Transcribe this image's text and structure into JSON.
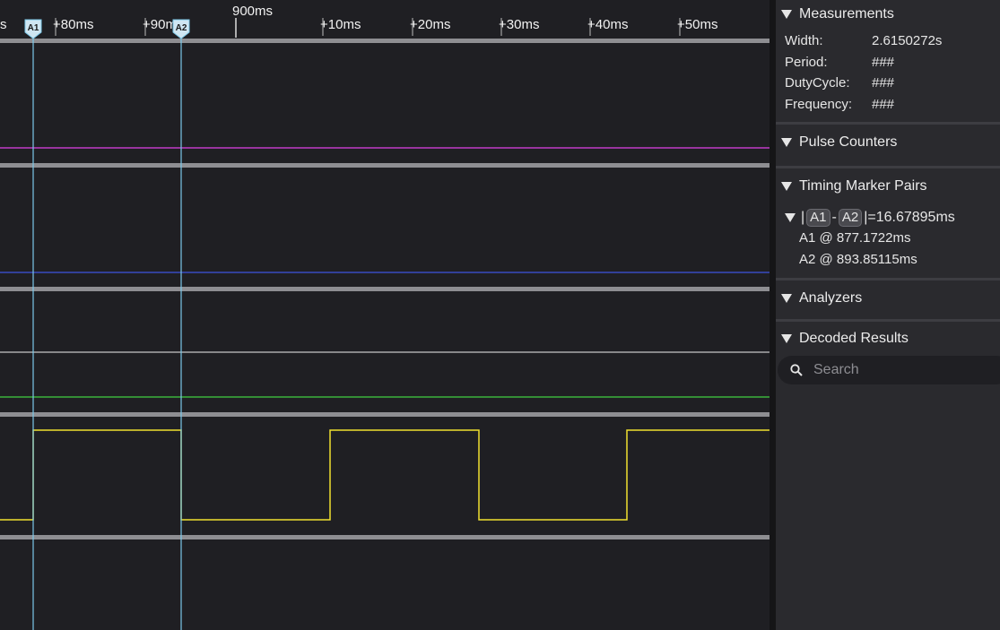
{
  "timeline": {
    "ticks": [
      "s",
      "+80ms",
      "+90ms",
      "900ms",
      "+10ms",
      "+20ms",
      "+30ms",
      "+40ms",
      "+50ms"
    ],
    "markers": [
      {
        "label": "A1",
        "time_ms": 877.1722
      },
      {
        "label": "A2",
        "time_ms": 893.85115
      }
    ]
  },
  "channels": {
    "colors": [
      "#e040e8",
      "#3d55e0",
      "#c8c8c8",
      "#40d040",
      "#f0e030"
    ],
    "clock_trace_color": "#f0e030",
    "marker_line_color": "#7cc8e8"
  },
  "panel": {
    "measurements": {
      "title": "Measurements",
      "rows": [
        {
          "key": "Width:",
          "value": "2.6150272s"
        },
        {
          "key": "Period:",
          "value": "###"
        },
        {
          "key": "DutyCycle:",
          "value": "###"
        },
        {
          "key": "Frequency:",
          "value": "###"
        }
      ]
    },
    "pulse_counters": {
      "title": "Pulse Counters"
    },
    "timing_marker_pairs": {
      "title": "Timing Marker Pairs",
      "pair": {
        "open_bar": "|",
        "a": "A1",
        "dash": "-",
        "b": "A2",
        "result": "|=16.67895ms",
        "a_line": "A1  @ 877.1722ms",
        "b_line": "A2 @ 893.85115ms"
      }
    },
    "analyzers": {
      "title": "Analyzers"
    },
    "decoded_results": {
      "title": "Decoded Results",
      "search_placeholder": "Search"
    }
  }
}
